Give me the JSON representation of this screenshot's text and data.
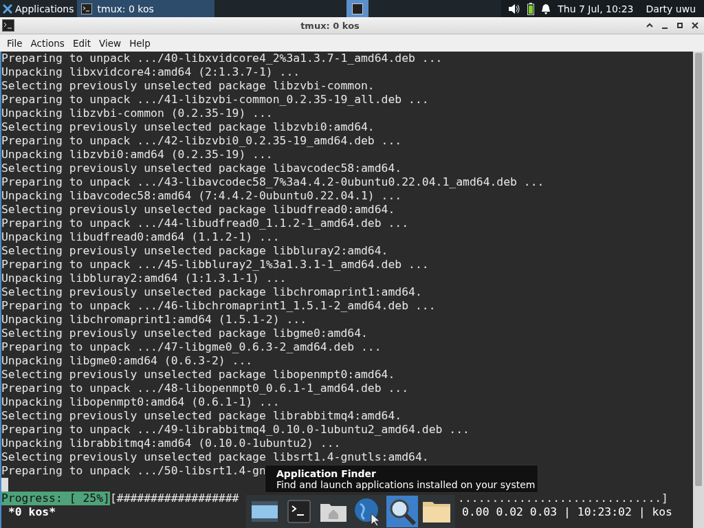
{
  "taskbar": {
    "apps_menu": "Applications",
    "tasks": [
      {
        "label": "tmux: 0 kos",
        "selected": true
      }
    ],
    "workspaces": [
      {
        "selected": true
      }
    ],
    "clock": "Thu  7 Jul, 10:23",
    "user": "Darty uwu"
  },
  "window": {
    "title": "tmux: 0 kos"
  },
  "menu": [
    "File",
    "Actions",
    "Edit",
    "View",
    "Help"
  ],
  "terminal": {
    "lines": [
      "Preparing to unpack .../40-libxvidcore4_2%3a1.3.7-1_amd64.deb ...",
      "Unpacking libxvidcore4:amd64 (2:1.3.7-1) ...",
      "Selecting previously unselected package libzvbi-common.",
      "Preparing to unpack .../41-libzvbi-common_0.2.35-19_all.deb ...",
      "Unpacking libzvbi-common (0.2.35-19) ...",
      "Selecting previously unselected package libzvbi0:amd64.",
      "Preparing to unpack .../42-libzvbi0_0.2.35-19_amd64.deb ...",
      "Unpacking libzvbi0:amd64 (0.2.35-19) ...",
      "Selecting previously unselected package libavcodec58:amd64.",
      "Preparing to unpack .../43-libavcodec58_7%3a4.4.2-0ubuntu0.22.04.1_amd64.deb ...",
      "Unpacking libavcodec58:amd64 (7:4.4.2-0ubuntu0.22.04.1) ...",
      "Selecting previously unselected package libudfread0:amd64.",
      "Preparing to unpack .../44-libudfread0_1.1.2-1_amd64.deb ...",
      "Unpacking libudfread0:amd64 (1.1.2-1) ...",
      "Selecting previously unselected package libbluray2:amd64.",
      "Preparing to unpack .../45-libbluray2_1%3a1.3.1-1_amd64.deb ...",
      "Unpacking libbluray2:amd64 (1:1.3.1-1) ...",
      "Selecting previously unselected package libchromaprint1:amd64.",
      "Preparing to unpack .../46-libchromaprint1_1.5.1-2_amd64.deb ...",
      "Unpacking libchromaprint1:amd64 (1.5.1-2) ...",
      "Selecting previously unselected package libgme0:amd64.",
      "Preparing to unpack .../47-libgme0_0.6.3-2_amd64.deb ...",
      "Unpacking libgme0:amd64 (0.6.3-2) ...",
      "Selecting previously unselected package libopenmpt0:amd64.",
      "Preparing to unpack .../48-libopenmpt0_0.6.1-1_amd64.deb ...",
      "Unpacking libopenmpt0:amd64 (0.6.1-1) ...",
      "Selecting previously unselected package librabbitmq4:amd64.",
      "Preparing to unpack .../49-librabbitmq4_0.10.0-1ubuntu2_amd64.deb ...",
      "Unpacking librabbitmq4:amd64 (0.10.0-1ubuntu2) ...",
      "Selecting previously unselected package libsrt1.4-gnutls:amd64.",
      "Preparing to unpack .../50-libsrt1.4-gn"
    ],
    "progress": {
      "label": "Progress: [ 25%]",
      "bar_start": "[##################",
      "bar_end": "..............................]"
    },
    "status": {
      "session": "*0 kos*",
      "info": "0.00 0.02 0.03 | 10:23:02 | kos"
    }
  },
  "dock": [
    {
      "kind": "desktop",
      "selected": false
    },
    {
      "kind": "terminal",
      "selected": false
    },
    {
      "kind": "home",
      "selected": false
    },
    {
      "kind": "globe",
      "selected": false
    },
    {
      "kind": "search",
      "selected": true
    },
    {
      "kind": "folder",
      "selected": false
    }
  ],
  "tooltip": {
    "title": "Application Finder",
    "description": "Find and launch applications installed on your system"
  }
}
